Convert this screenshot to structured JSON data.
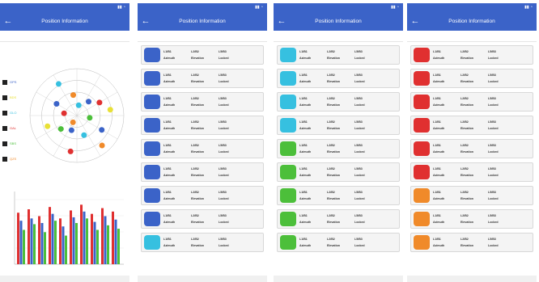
{
  "screens": [
    {
      "time": "",
      "title": "Position Information",
      "tabs": [
        "",
        "",
        ""
      ]
    },
    {
      "time": "",
      "title": "Position Information",
      "tabs": [
        "",
        "",
        ""
      ]
    },
    {
      "time": "",
      "title": "Position Information",
      "tabs": [
        "",
        "",
        ""
      ]
    },
    {
      "time": "",
      "title": "Position Information",
      "tabs": [
        "",
        "",
        ""
      ]
    }
  ],
  "constellations": [
    {
      "label": "GPS",
      "color": "#3b63c8"
    },
    {
      "label": "BDS",
      "color": "#e8e036"
    },
    {
      "label": "GLO",
      "color": "#36c0e0"
    },
    {
      "label": "GAL",
      "color": "#e03030"
    },
    {
      "label": "SBS",
      "color": "#4cbf3a"
    },
    {
      "label": "QZS",
      "color": "#f08a2a"
    }
  ],
  "field_labels": {
    "l1": "L1/B1",
    "l2": "L2/B2",
    "l5": "L5/B3",
    "azimuth": "Azimuth",
    "elevation": "Elevation",
    "locked": "Locked"
  },
  "screen2_cards": [
    {
      "color": "#3b63c8",
      "l1": "",
      "l2": "",
      "l5": "",
      "az": ""
    },
    {
      "color": "#3b63c8",
      "l1": "",
      "l2": "",
      "l5": "",
      "az": ""
    },
    {
      "color": "#3b63c8",
      "l1": "",
      "l2": "",
      "l5": "",
      "az": ""
    },
    {
      "color": "#3b63c8",
      "l1": "",
      "l2": "",
      "l5": "",
      "az": ""
    },
    {
      "color": "#3b63c8",
      "l1": "",
      "l2": "",
      "l5": "",
      "az": ""
    },
    {
      "color": "#3b63c8",
      "l1": "",
      "l2": "",
      "l5": "",
      "az": ""
    },
    {
      "color": "#3b63c8",
      "l1": "",
      "l2": "",
      "l5": "",
      "az": ""
    },
    {
      "color": "#3b63c8",
      "l1": "",
      "l2": "",
      "l5": "",
      "az": ""
    },
    {
      "color": "#36c0e0",
      "l1": "",
      "l2": "",
      "l5": "",
      "az": ""
    }
  ],
  "screen3_cards": [
    {
      "color": "#36c0e0",
      "l1": "",
      "l2": "",
      "l5": "",
      "az": ""
    },
    {
      "color": "#36c0e0",
      "l1": "",
      "l2": "",
      "l5": "",
      "az": ""
    },
    {
      "color": "#36c0e0",
      "l1": "",
      "l2": "",
      "l5": "",
      "az": ""
    },
    {
      "color": "#36c0e0",
      "l1": "",
      "l2": "",
      "l5": "",
      "az": ""
    },
    {
      "color": "#4cbf3a",
      "l1": "",
      "l2": "",
      "l5": "",
      "az": ""
    },
    {
      "color": "#4cbf3a",
      "l1": "",
      "l2": "",
      "l5": "",
      "az": ""
    },
    {
      "color": "#4cbf3a",
      "l1": "",
      "l2": "",
      "l5": "",
      "az": ""
    },
    {
      "color": "#4cbf3a",
      "l1": "",
      "l2": "",
      "l5": "",
      "az": ""
    },
    {
      "color": "#4cbf3a",
      "l1": "",
      "l2": "",
      "l5": "",
      "az": ""
    }
  ],
  "screen4_cards": [
    {
      "color": "#e03030",
      "l1": "",
      "l2": "",
      "l5": "",
      "az": ""
    },
    {
      "color": "#e03030",
      "l1": "",
      "l2": "",
      "l5": "",
      "az": ""
    },
    {
      "color": "#e03030",
      "l1": "",
      "l2": "",
      "l5": "",
      "az": ""
    },
    {
      "color": "#e03030",
      "l1": "",
      "l2": "",
      "l5": "",
      "az": ""
    },
    {
      "color": "#e03030",
      "l1": "",
      "l2": "",
      "l5": "",
      "az": ""
    },
    {
      "color": "#e03030",
      "l1": "",
      "l2": "",
      "l5": "",
      "az": ""
    },
    {
      "color": "#f08a2a",
      "l1": "",
      "l2": "",
      "l5": "",
      "az": ""
    },
    {
      "color": "#f08a2a",
      "l1": "",
      "l2": "",
      "l5": "",
      "az": ""
    },
    {
      "color": "#f08a2a",
      "l1": "",
      "l2": "",
      "l5": "",
      "az": ""
    }
  ],
  "sats": [
    {
      "color": "#3b63c8",
      "az": 40,
      "el": 55
    },
    {
      "color": "#3b63c8",
      "az": 120,
      "el": 35
    },
    {
      "color": "#3b63c8",
      "az": 200,
      "el": 60
    },
    {
      "color": "#3b63c8",
      "az": 300,
      "el": 45
    },
    {
      "color": "#e8e036",
      "az": 80,
      "el": 25
    },
    {
      "color": "#e8e036",
      "az": 250,
      "el": 30
    },
    {
      "color": "#36c0e0",
      "az": 10,
      "el": 70
    },
    {
      "color": "#36c0e0",
      "az": 160,
      "el": 50
    },
    {
      "color": "#36c0e0",
      "az": 330,
      "el": 20
    },
    {
      "color": "#e03030",
      "az": 60,
      "el": 40
    },
    {
      "color": "#e03030",
      "az": 190,
      "el": 20
    },
    {
      "color": "#e03030",
      "az": 280,
      "el": 65
    },
    {
      "color": "#4cbf3a",
      "az": 100,
      "el": 65
    },
    {
      "color": "#4cbf3a",
      "az": 230,
      "el": 50
    },
    {
      "color": "#f08a2a",
      "az": 140,
      "el": 15
    },
    {
      "color": "#f08a2a",
      "az": 350,
      "el": 50
    },
    {
      "color": "#f08a2a",
      "az": 210,
      "el": 75
    }
  ],
  "bars": [
    {
      "l1": 45,
      "l2": 38,
      "l5": 30,
      "color": "#3b63c8"
    },
    {
      "l1": 48,
      "l2": 40,
      "l5": 35,
      "color": "#e03030"
    },
    {
      "l1": 42,
      "l2": 36,
      "l5": 28,
      "color": "#4cbf3a"
    },
    {
      "l1": 50,
      "l2": 44,
      "l5": 38,
      "color": "#3b63c8"
    },
    {
      "l1": 40,
      "l2": 33,
      "l5": 25,
      "color": "#e03030"
    },
    {
      "l1": 47,
      "l2": 41,
      "l5": 36,
      "color": "#4cbf3a"
    },
    {
      "l1": 52,
      "l2": 46,
      "l5": 40,
      "color": "#3b63c8"
    },
    {
      "l1": 44,
      "l2": 37,
      "l5": 30,
      "color": "#e03030"
    },
    {
      "l1": 49,
      "l2": 42,
      "l5": 34,
      "color": "#4cbf3a"
    },
    {
      "l1": 46,
      "l2": 39,
      "l5": 31,
      "color": "#3b63c8"
    }
  ],
  "bar_max": 60
}
